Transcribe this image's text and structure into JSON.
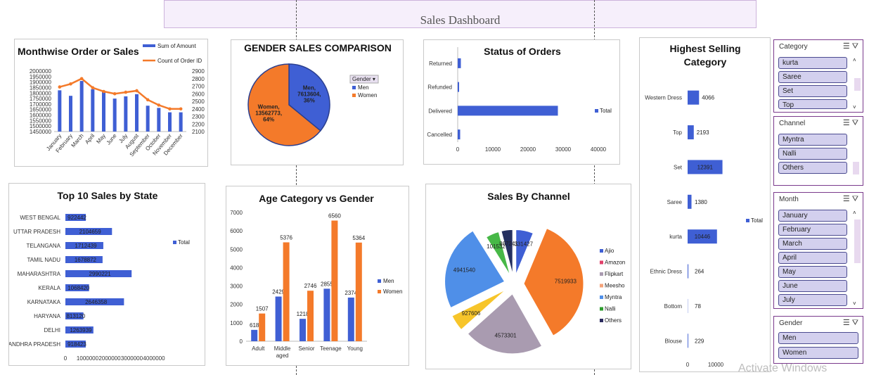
{
  "dashboard_title": "Sales Dashboard",
  "watermark": "Activate Windows",
  "colors": {
    "blue": "#3f5fd4",
    "orange": "#f47a2a",
    "purple_border": "#7a3a8c"
  },
  "chart_data": [
    {
      "id": "monthwise",
      "type": "bar+line",
      "title": "Monthwise Order or Sales",
      "categories": [
        "January",
        "February",
        "March",
        "April",
        "May",
        "June",
        "July",
        "August",
        "September",
        "October",
        "November",
        "December"
      ],
      "series": [
        {
          "name": "Sum of Amount",
          "type": "bar",
          "axis": "left",
          "values": [
            1825000,
            1775000,
            1910000,
            1835000,
            1815000,
            1750000,
            1770000,
            1790000,
            1685000,
            1665000,
            1625000,
            1625000
          ]
        },
        {
          "name": "Count of Order ID",
          "type": "line",
          "axis": "right",
          "values": [
            2690,
            2730,
            2800,
            2680,
            2630,
            2600,
            2620,
            2640,
            2520,
            2450,
            2400,
            2400
          ]
        }
      ],
      "ylim_left": [
        1450000,
        2000000
      ],
      "yticks_left": [
        "2000000",
        "1950000",
        "1900000",
        "1850000",
        "1800000",
        "1750000",
        "1700000",
        "1650000",
        "1600000",
        "1550000",
        "1500000",
        "1450000"
      ],
      "ylim_right": [
        2100,
        2900
      ],
      "yticks_right": [
        "2900",
        "2800",
        "2700",
        "2600",
        "2500",
        "2400",
        "2300",
        "2200",
        "2100"
      ],
      "legend": "top-right"
    },
    {
      "id": "gender",
      "type": "pie",
      "title": "GENDER SALES COMPARISON",
      "categories": [
        "Men",
        "Women"
      ],
      "values": [
        7613604,
        13562773
      ],
      "percent": [
        "36%",
        "64%"
      ],
      "labels": [
        "Men,\n7613604,\n36%",
        "Women,\n13562773,\n64%"
      ],
      "legend_title": "Gender",
      "legend": "right"
    },
    {
      "id": "status",
      "type": "bar",
      "title": "Status of Orders",
      "categories": [
        "Returned",
        "Refunded",
        "Delivered",
        "Cancelled"
      ],
      "values": [
        900,
        400,
        28500,
        700
      ],
      "xlim": [
        0,
        40000
      ],
      "xticks": [
        "0",
        "10000",
        "20000",
        "30000",
        "40000"
      ],
      "series_name": "Total",
      "legend": "right"
    },
    {
      "id": "category",
      "type": "bar",
      "title": "Highest Selling\nCategory",
      "categories": [
        "Western Dress",
        "Top",
        "Set",
        "Saree",
        "kurta",
        "Ethnic Dress",
        "Bottom",
        "Blouse"
      ],
      "values": [
        4066,
        2193,
        12391,
        1380,
        10446,
        264,
        78,
        229
      ],
      "xlim": [
        0,
        20000
      ],
      "xticks": [
        "0",
        "10000"
      ],
      "series_name": "Total",
      "legend": "right"
    },
    {
      "id": "state",
      "type": "bar",
      "title": "Top 10 Sales by State",
      "categories": [
        "WEST BENGAL",
        "UTTAR PRADESH",
        "TELANGANA",
        "TAMIL NADU",
        "MAHARASHTRA",
        "KERALA",
        "KARNATAKA",
        "HARYANA",
        "DELHI",
        "ANDHRA PRADESH"
      ],
      "values": [
        922442,
        2104659,
        1712439,
        1678872,
        2990221,
        1068420,
        2646358,
        813120,
        1263939,
        918423
      ],
      "xlim": [
        0,
        4000000
      ],
      "xticks": [
        "0",
        "1000000",
        "2000000",
        "3000000",
        "4000000"
      ],
      "series_name": "Total",
      "legend": "right"
    },
    {
      "id": "age",
      "type": "bar",
      "title": "Age Category vs Gender",
      "categories": [
        "Adult",
        "Middle\naged",
        "Senior",
        "Teenage",
        "Young"
      ],
      "series": [
        {
          "name": "Men",
          "values": [
            618,
            2429,
            1218,
            2855,
            2374
          ]
        },
        {
          "name": "Women",
          "values": [
            1507,
            5376,
            2746,
            6560,
            5364
          ]
        }
      ],
      "ylim": [
        0,
        7000
      ],
      "yticks": [
        "0",
        "1000",
        "2000",
        "3000",
        "4000",
        "5000",
        "6000",
        "7000"
      ],
      "legend": "right"
    },
    {
      "id": "channel",
      "type": "pie",
      "title": "Sales By Channel",
      "categories": [
        "Ajio",
        "Amazon",
        "Flipkart",
        "Meesho",
        "Myntra",
        "Nalli",
        "Others"
      ],
      "legend_order": [
        "Ajio",
        "Amazon",
        "Flipkart",
        "Meesho",
        "Myntra",
        "Nalli",
        "Others"
      ],
      "values": [
        1331427,
        7519933,
        4573301,
        927606,
        4941540,
        1015329,
        867241
      ],
      "labels": [
        "1331427",
        "7519933",
        "4573301",
        "927606",
        "4941540",
        "1015329",
        "867241"
      ],
      "legend": "right"
    }
  ],
  "slicers": [
    {
      "id": "category",
      "title": "Category",
      "items": [
        "kurta",
        "Saree",
        "Set",
        "Top"
      ]
    },
    {
      "id": "channel",
      "title": "Channel",
      "items": [
        "Myntra",
        "Nalli",
        "Others"
      ]
    },
    {
      "id": "month",
      "title": "Month",
      "items": [
        "January",
        "February",
        "March",
        "April",
        "May",
        "June",
        "July"
      ]
    },
    {
      "id": "gender",
      "title": "Gender",
      "items": [
        "Men",
        "Women"
      ]
    }
  ]
}
